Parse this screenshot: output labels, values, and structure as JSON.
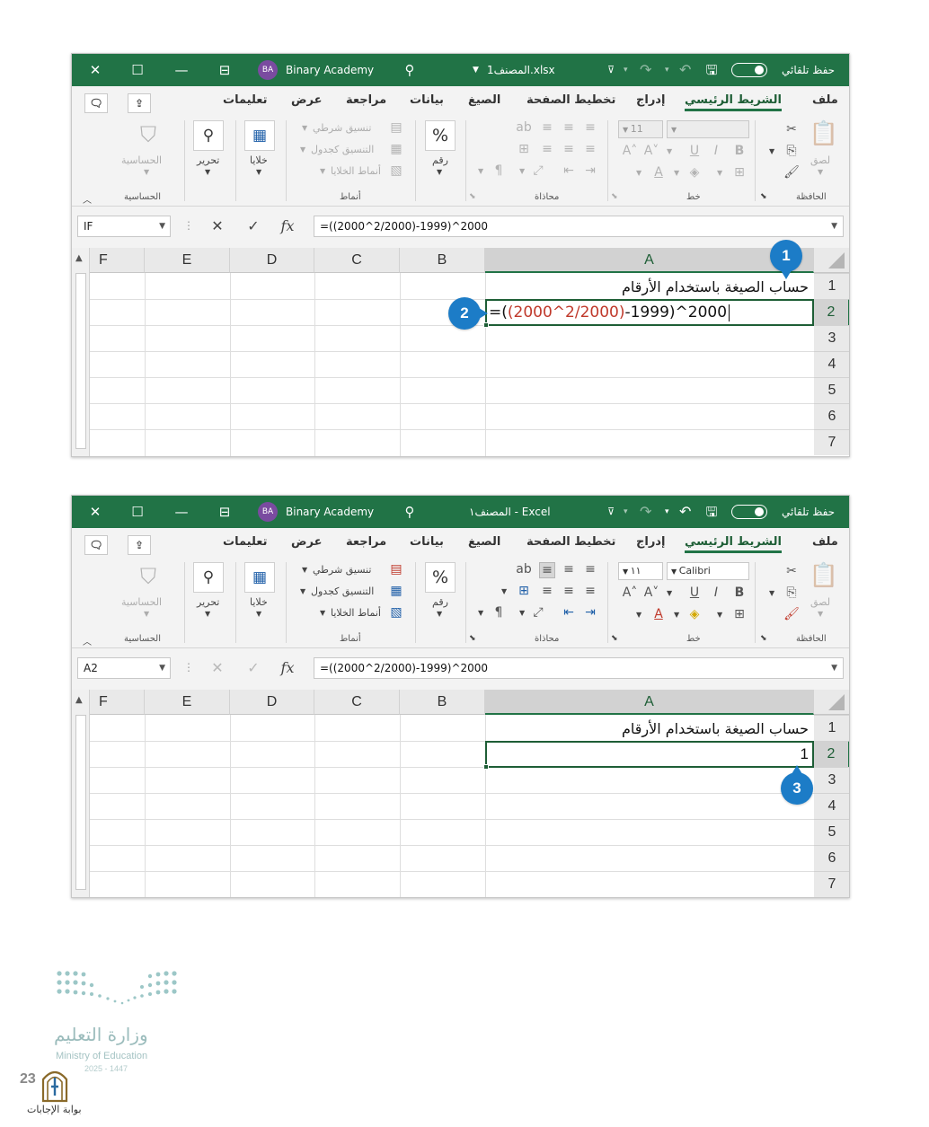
{
  "common": {
    "account_name": "Binary Academy",
    "account_initials": "BA",
    "autosave_label": "حفظ تلقائي",
    "tabs": [
      "ملف",
      "الشريط الرئيسي",
      "إدراج",
      "تخطيط الصفحة",
      "الصيغ",
      "بيانات",
      "مراجعة",
      "عرض",
      "تعليمات"
    ],
    "groups": {
      "clipboard": "الحافظة",
      "paste": "لصق",
      "font": "خط",
      "alignment": "محاذاة",
      "number": "رقم",
      "styles": "أنماط",
      "conditional_formatting": "تنسيق شرطي",
      "format_as_table": "التنسيق كجدول",
      "cell_styles": "أنماط الخلايا",
      "cells": "خلايا",
      "editing": "تحرير",
      "sensitivity": "الحساسية",
      "sensitivity_group": "الحساسية"
    },
    "columns": [
      "A",
      "B",
      "C",
      "D",
      "E",
      "F"
    ],
    "rows": [
      "1",
      "2",
      "3",
      "4",
      "5",
      "6",
      "7"
    ],
    "cell_a1": "حساب الصيغة باستخدام الأرقام"
  },
  "window1": {
    "file_title": "المصنف1.xlsx",
    "font_size": "11",
    "name_box": "IF",
    "formula_bar": "=((2000^2/2000)-1999)^2000",
    "cell_edit": {
      "p1": "=(",
      "p2": "(2000^2/2000",
      "p3": ")",
      "p4": "-1999",
      "p5": ")",
      "p6": "^2000"
    }
  },
  "window2": {
    "file_title": "المصنف١  -  Excel",
    "font_name": "Calibri",
    "font_size": "١١",
    "name_box": "A2",
    "formula_bar": "=((2000^2/2000)-1999)^2000",
    "cell_a2_value": "1"
  },
  "callouts": [
    "1",
    "2",
    "3"
  ],
  "footer": {
    "ministry_ar": "وزارة التعليم",
    "ministry_en": "Ministry of Education",
    "year": "2025 - 1447",
    "page": "23",
    "site": "بوابة الإجابات"
  },
  "colors": {
    "excel_green": "#217346",
    "callout_blue": "#1c7cc7",
    "formula_red": "#c0392b"
  }
}
